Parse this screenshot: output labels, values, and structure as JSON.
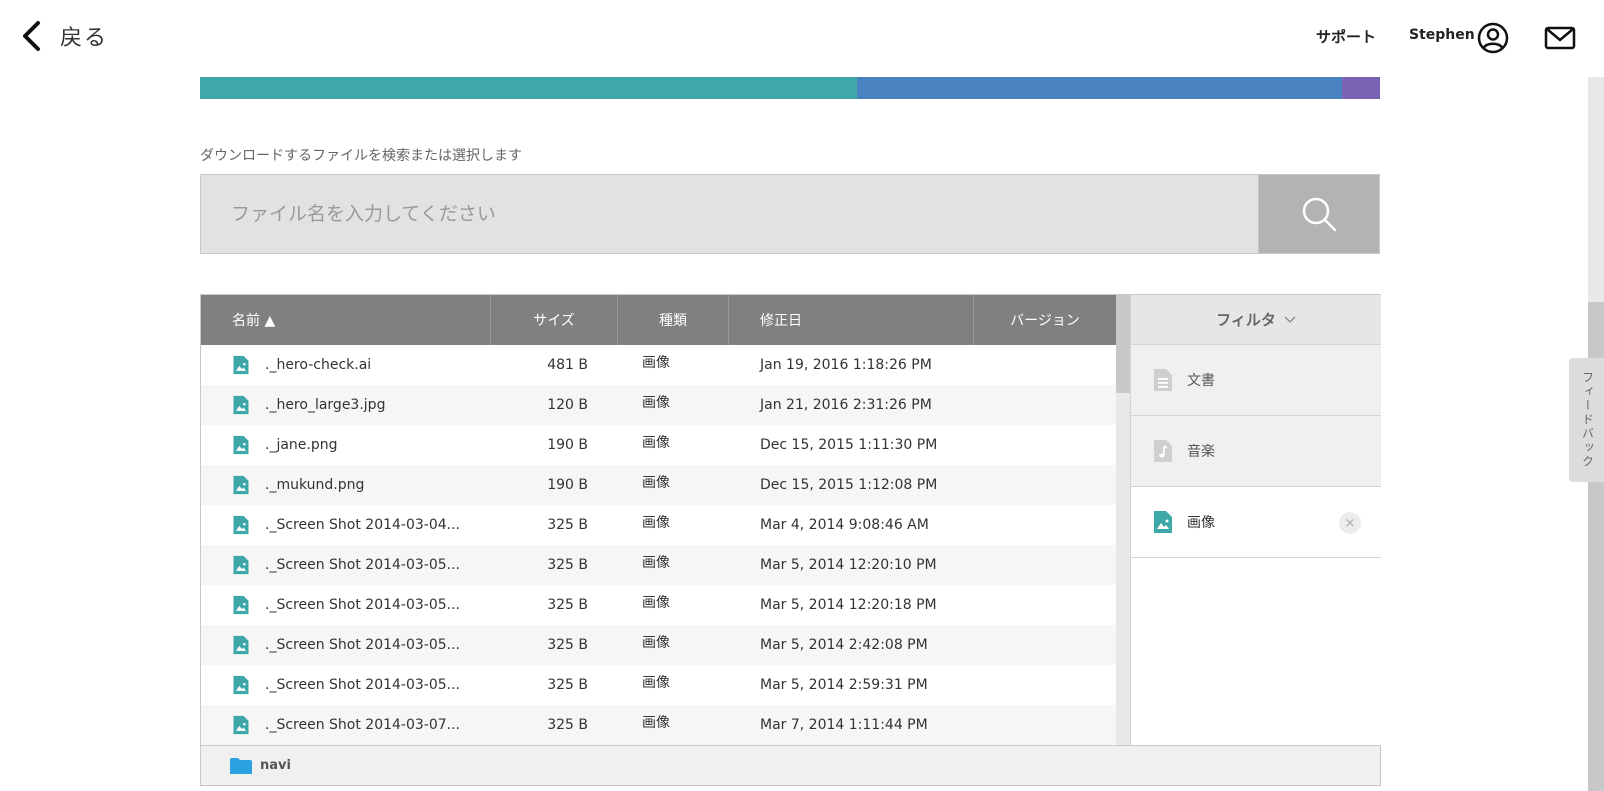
{
  "header": {
    "back_label": "戻る",
    "support": "サポート",
    "username": "Stephen"
  },
  "storage_bar": {
    "segments": [
      {
        "color": "#3ea8a8",
        "fraction": 0.557
      },
      {
        "color": "#4b83c2",
        "fraction": 0.411
      },
      {
        "color": "#7a63b2",
        "fraction": 0.032
      }
    ]
  },
  "search": {
    "label": "ダウンロードするファイルを検索または選択します",
    "placeholder": "ファイル名を入力してください"
  },
  "table": {
    "columns": {
      "name": "名前 ▲",
      "size": "サイズ",
      "type": "種類",
      "modified": "修正日",
      "version": "バージョン"
    },
    "rows": [
      {
        "name": "._hero-check.ai",
        "size": "481 B",
        "type": "画像",
        "modified": "Jan 19, 2016 1:18:26 PM"
      },
      {
        "name": "._hero_large3.jpg",
        "size": "120 B",
        "type": "画像",
        "modified": "Jan 21, 2016 2:31:26 PM"
      },
      {
        "name": "._jane.png",
        "size": "190 B",
        "type": "画像",
        "modified": "Dec 15, 2015 1:11:30 PM"
      },
      {
        "name": "._mukund.png",
        "size": "190 B",
        "type": "画像",
        "modified": "Dec 15, 2015 1:12:08 PM"
      },
      {
        "name": "._Screen Shot 2014-03-04...",
        "size": "325 B",
        "type": "画像",
        "modified": "Mar 4, 2014 9:08:46 AM"
      },
      {
        "name": "._Screen Shot 2014-03-05...",
        "size": "325 B",
        "type": "画像",
        "modified": "Mar 5, 2014 12:20:10 PM"
      },
      {
        "name": "._Screen Shot 2014-03-05...",
        "size": "325 B",
        "type": "画像",
        "modified": "Mar 5, 2014 12:20:18 PM"
      },
      {
        "name": "._Screen Shot 2014-03-05...",
        "size": "325 B",
        "type": "画像",
        "modified": "Mar 5, 2014 2:42:08 PM"
      },
      {
        "name": "._Screen Shot 2014-03-05...",
        "size": "325 B",
        "type": "画像",
        "modified": "Mar 5, 2014 2:59:31 PM"
      },
      {
        "name": "._Screen Shot 2014-03-07...",
        "size": "325 B",
        "type": "画像",
        "modified": "Mar 7, 2014 1:11:44 PM"
      }
    ]
  },
  "filter": {
    "title": "フィルタ",
    "items": [
      {
        "label": "文書",
        "icon": "document-icon"
      },
      {
        "label": "音楽",
        "icon": "music-icon"
      },
      {
        "label": "画像",
        "icon": "image-icon"
      }
    ],
    "close": "×"
  },
  "footer": {
    "folder": "navi"
  },
  "feedback": {
    "label": "フィードバック"
  },
  "colors": {
    "accent": "#3ea8a8",
    "header_bg": "#808080",
    "folder": "#2aa1e0"
  }
}
